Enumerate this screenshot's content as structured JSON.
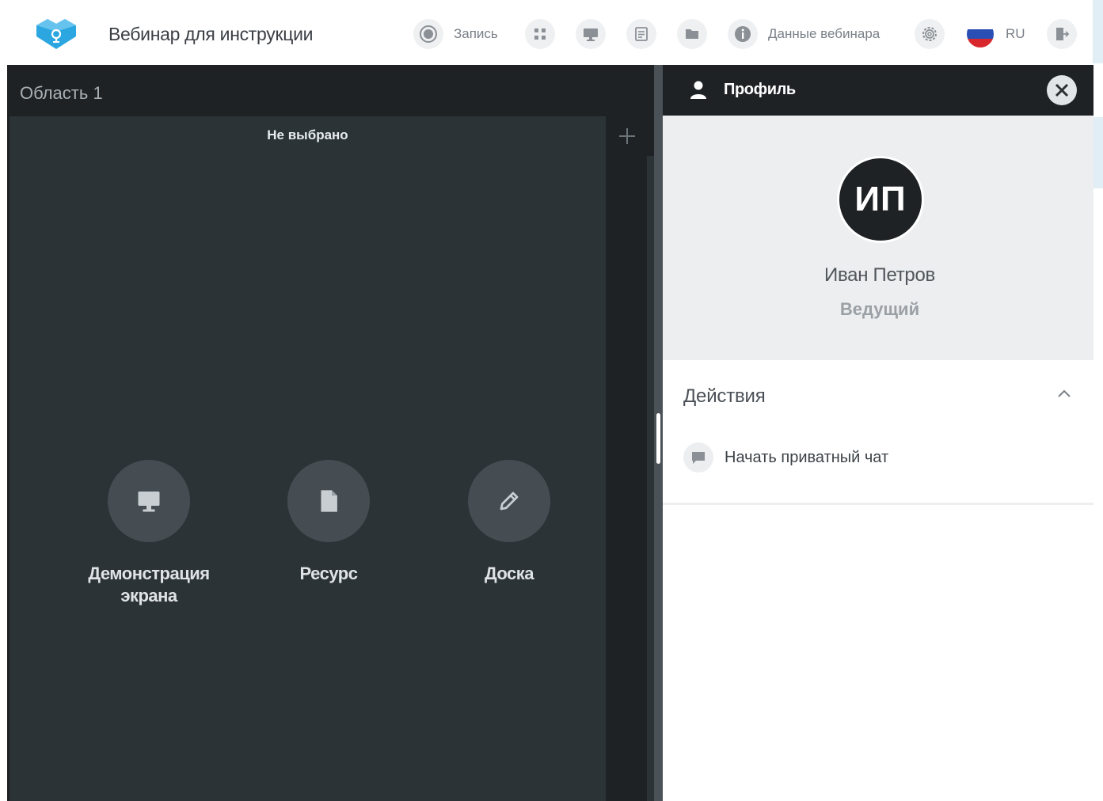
{
  "header": {
    "title": "Вебинар для инструкции",
    "record_label": "Запись",
    "webinar_data_label": "Данные вебинара",
    "language": "RU"
  },
  "stage": {
    "area_title": "Область 1",
    "tab_label": "Не выбрано",
    "choices": [
      {
        "label": "Демонстрация\nэкрана",
        "icon": "monitor-icon"
      },
      {
        "label": "Ресурс",
        "icon": "file-icon"
      },
      {
        "label": "Доска",
        "icon": "pencil-icon"
      }
    ]
  },
  "panel": {
    "title": "Профиль",
    "avatar_initials": "ИП",
    "user_name": "Иван Петров",
    "user_role": "Ведущий",
    "actions_title": "Действия",
    "actions": [
      {
        "label": "Начать приватный чат",
        "icon": "chat-icon"
      }
    ]
  },
  "colors": {
    "accent": "#2ba6e0",
    "dark": "#1e2225",
    "board": "#2c3337"
  }
}
